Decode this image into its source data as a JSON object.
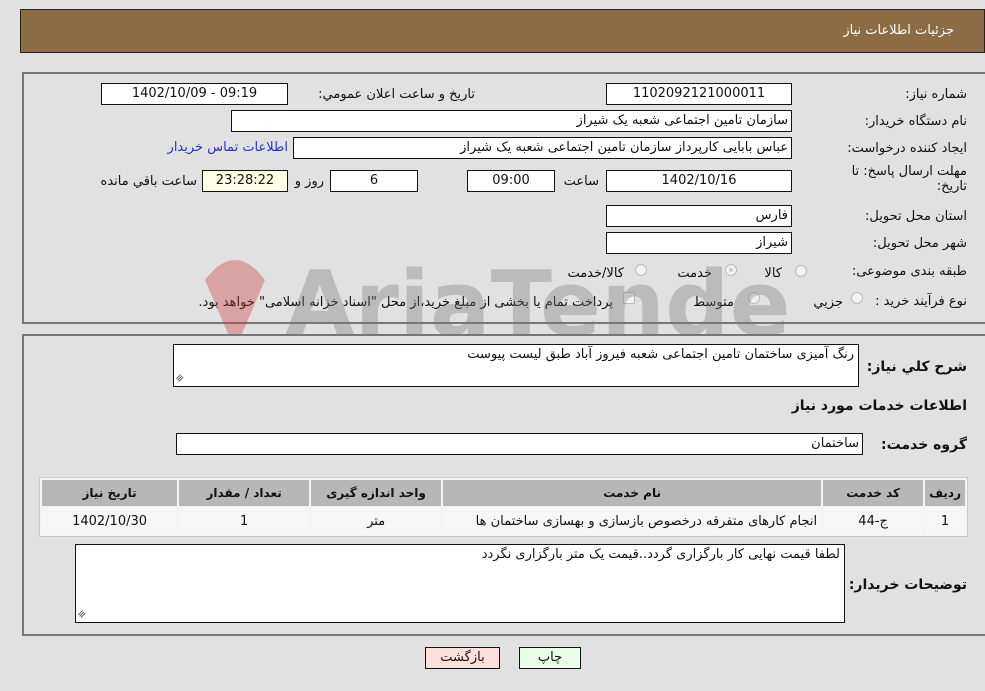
{
  "header": {
    "title": "جزئیات اطلاعات نیاز"
  },
  "details": {
    "need_number": {
      "label": "شماره نیاز:",
      "value": "1102092121000011"
    },
    "announce_datetime": {
      "label": "تاریخ و ساعت اعلان عمومي:",
      "value": "1402/10/09 - 09:19"
    },
    "buyer_org": {
      "label": "نام دستگاه خریدار:",
      "value": "سازمان تامین اجتماعی شعبه یک شیراز"
    },
    "requester": {
      "label": "ایجاد کننده درخواست:",
      "value": "عباس  بابایی  کارپرداز  سازمان تامین اجتماعی شعبه یک شیراز"
    },
    "buyer_contact_link": "اطلاعات تماس خریدار",
    "deadline": {
      "label_line1": "مهلت ارسال پاسخ: تا",
      "label_line2": "تاریخ:",
      "date": "1402/10/16",
      "time_label": "ساعت",
      "time": "09:00",
      "days": "6",
      "days_label": "روز و",
      "remaining": "23:28:22",
      "remaining_label": "ساعت باقي مانده"
    },
    "province": {
      "label": "استان محل تحویل:",
      "value": "فارس"
    },
    "city": {
      "label": "شهر محل تحویل:",
      "value": "شیراز"
    },
    "category": {
      "label": "طبقه بندی موضوعی:",
      "options": [
        "کالا",
        "خدمت",
        "کالا/خدمت"
      ],
      "selected": "خدمت"
    },
    "purchase_type": {
      "label": "نوع فرآیند خرید :",
      "options": [
        "جزيي",
        "متوسط"
      ],
      "treasury_note": "پرداخت تمام یا بخشی از مبلغ خرید،از محل \"اسناد خزانه اسلامی\" خواهد بود."
    }
  },
  "summary": {
    "label": "شرح کلي نیاز:",
    "value": "رنگ آمیزی ساختمان تامین اجتماعی شعبه فیروز آباد طبق لیست پیوست"
  },
  "services_section_title": "اطلاعات خدمات مورد نیاز",
  "service_group": {
    "label": "گروه خدمت:",
    "value": "ساختمان"
  },
  "table": {
    "headers": [
      "ردیف",
      "کد خدمت",
      "نام خدمت",
      "واحد اندازه گیری",
      "تعداد / مقدار",
      "تاریخ نیاز"
    ],
    "rows": [
      [
        "1",
        "ج-44",
        "انجام کارهای متفرقه درخصوص بازسازی و بهسازی ساختمان ها",
        "متر",
        "1",
        "1402/10/30"
      ]
    ]
  },
  "buyer_notes": {
    "label": "توضیحات خریدار:",
    "value": "لطفا قیمت نهایی کار بارگزاری گردد..قیمت یک متر بارگزاری نگردد"
  },
  "buttons": {
    "print": "چاپ",
    "back": "بازگشت"
  },
  "watermark": "AriaTender.neT"
}
